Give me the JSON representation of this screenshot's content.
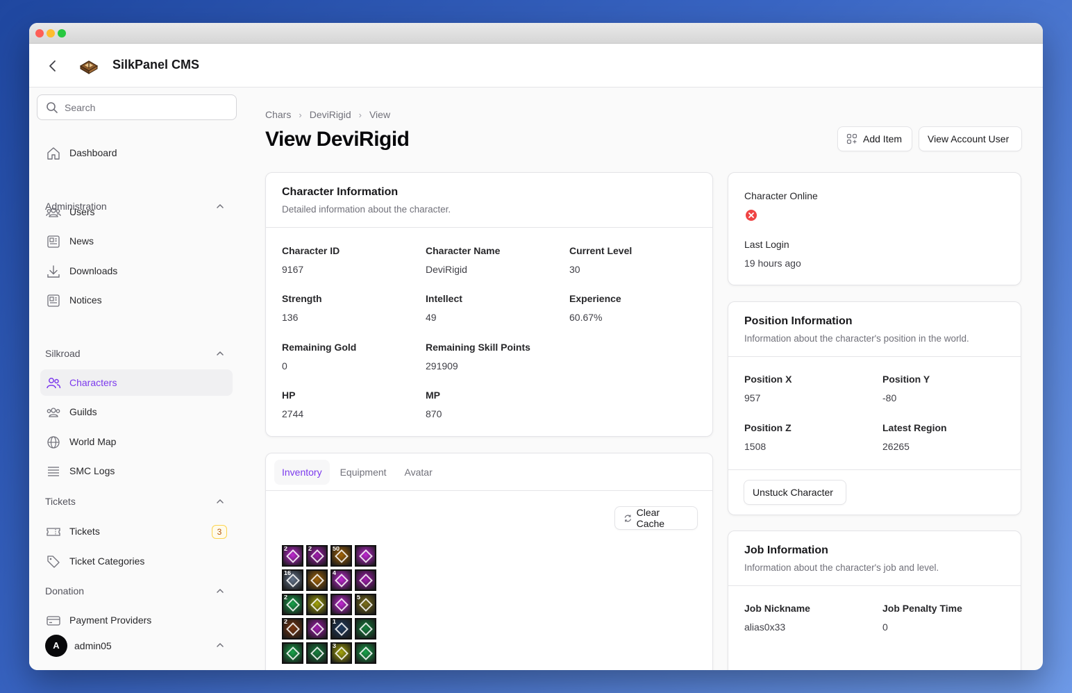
{
  "window": {
    "controls": [
      "close",
      "minimize",
      "maximize"
    ]
  },
  "topbar": {
    "brand": "SilkPanel CMS"
  },
  "sidebar": {
    "search_placeholder": "Search",
    "dashboard": "Dashboard",
    "groups": {
      "administration": "Administration",
      "silkroad": "Silkroad",
      "tickets": "Tickets",
      "donation": "Donation"
    },
    "items": {
      "users": "Users",
      "news": "News",
      "downloads": "Downloads",
      "notices": "Notices",
      "characters": "Characters",
      "guilds": "Guilds",
      "world_map": "World Map",
      "smc_logs": "SMC Logs",
      "tickets": "Tickets",
      "tickets_badge": "3",
      "ticket_categories": "Ticket Categories",
      "payment_providers": "Payment Providers"
    },
    "user": {
      "initial": "A",
      "name": "admin05"
    }
  },
  "breadcrumb": {
    "chars": "Chars",
    "name": "DeviRigid",
    "view": "View"
  },
  "page": {
    "title": "View DeviRigid",
    "add_item": "Add Item",
    "view_account_user": "View Account User"
  },
  "character_info": {
    "title": "Character Information",
    "subtitle": "Detailed information about the character.",
    "fields": {
      "character_id_label": "Character ID",
      "character_id": "9167",
      "character_name_label": "Character Name",
      "character_name": "DeviRigid",
      "current_level_label": "Current Level",
      "current_level": "30",
      "strength_label": "Strength",
      "strength": "136",
      "intellect_label": "Intellect",
      "intellect": "49",
      "experience_label": "Experience",
      "experience": "60.67%",
      "remaining_gold_label": "Remaining Gold",
      "remaining_gold": "0",
      "remaining_skill_points_label": "Remaining Skill Points",
      "remaining_skill_points": "291909",
      "hp_label": "HP",
      "hp": "2744",
      "mp_label": "MP",
      "mp": "870"
    }
  },
  "status": {
    "online_label": "Character Online",
    "online": false,
    "last_login_label": "Last Login",
    "last_login": "19 hours ago"
  },
  "position": {
    "title": "Position Information",
    "subtitle": "Information about the character's position in the world.",
    "x_label": "Position X",
    "x": "957",
    "y_label": "Position Y",
    "y": "-80",
    "z_label": "Position Z",
    "z": "1508",
    "region_label": "Latest Region",
    "region": "26265",
    "unstuck": "Unstuck Character"
  },
  "job": {
    "title": "Job Information",
    "subtitle": "Information about the character's job and level.",
    "nickname_label": "Job Nickname",
    "nickname": "alias0x33",
    "penalty_label": "Job Penalty Time",
    "penalty": "0"
  },
  "inventory": {
    "tabs": [
      "Inventory",
      "Equipment",
      "Avatar"
    ],
    "active_tab": "Inventory",
    "clear_cache": "Clear Cache",
    "items": [
      {
        "qty": "2",
        "color": "#c026d3"
      },
      {
        "qty": "2",
        "color": "#a21caf"
      },
      {
        "qty": "50",
        "color": "#a16207"
      },
      {
        "qty": "",
        "color": "#c026d3"
      },
      {
        "qty": "16",
        "color": "#64748b"
      },
      {
        "qty": "",
        "color": "#a16207"
      },
      {
        "qty": "4",
        "color": "#c026d3"
      },
      {
        "qty": "",
        "color": "#a21caf"
      },
      {
        "qty": "2",
        "color": "#16a34a"
      },
      {
        "qty": "",
        "color": "#a3a30a"
      },
      {
        "qty": "",
        "color": "#c026d3"
      },
      {
        "qty": "5",
        "color": "#7c6f1a"
      },
      {
        "qty": "2",
        "color": "#78350f"
      },
      {
        "qty": "",
        "color": "#a21caf"
      },
      {
        "qty": "1",
        "color": "#1e3a5f"
      },
      {
        "qty": "",
        "color": "#15803d"
      },
      {
        "qty": "",
        "color": "#16a34a"
      },
      {
        "qty": "",
        "color": "#15803d"
      },
      {
        "qty": "3",
        "color": "#a3a30a"
      },
      {
        "qty": "",
        "color": "#16a34a"
      }
    ]
  },
  "colors": {
    "accent": "#7c3aed",
    "offline": "#ef4444"
  }
}
